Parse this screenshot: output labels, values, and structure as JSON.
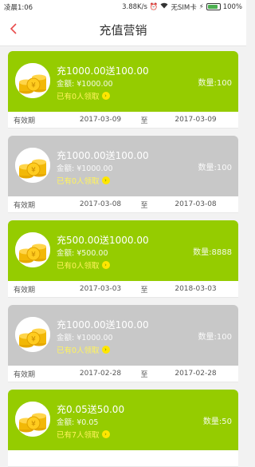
{
  "status": {
    "time": "凌晨1:06",
    "net_speed": "3.88K/s",
    "sim": "无SIM卡",
    "battery": "100%"
  },
  "header": {
    "title": "充值营销",
    "back_icon": "chevron-left-icon"
  },
  "colors": {
    "active": "#95cc00",
    "used": "#c8c8c8",
    "accent_yellow": "#fff35c",
    "back_arrow": "#e84c4c"
  },
  "cards": [
    {
      "state": "active",
      "title": "充1000.00送100.00",
      "amount": "金额: ¥1000.00",
      "claimed": "已有0人领取",
      "quantity": "数量:100",
      "label": "有效期",
      "start": "2017-03-09",
      "to": "至",
      "end": "2017-03-09"
    },
    {
      "state": "used",
      "title": "充1000.00送100.00",
      "amount": "金额: ¥1000.00",
      "claimed": "已有0人领取",
      "quantity": "数量:100",
      "label": "有效期",
      "start": "2017-03-08",
      "to": "至",
      "end": "2017-03-08"
    },
    {
      "state": "active",
      "title": "充500.00送1000.00",
      "amount": "金额: ¥500.00",
      "claimed": "已有0人领取",
      "quantity": "数量:8888",
      "label": "有效期",
      "start": "2017-03-03",
      "to": "至",
      "end": "2018-03-03"
    },
    {
      "state": "used",
      "title": "充1000.00送100.00",
      "amount": "金额: ¥1000.00",
      "claimed": "已有0人领取",
      "quantity": "数量:100",
      "label": "有效期",
      "start": "2017-02-28",
      "to": "至",
      "end": "2017-02-28"
    },
    {
      "state": "active",
      "title": "充0.05送50.00",
      "amount": "金额: ¥0.05",
      "claimed": "已有7人领取",
      "quantity": "数量:50",
      "label": "",
      "start": "",
      "to": "",
      "end": ""
    }
  ]
}
